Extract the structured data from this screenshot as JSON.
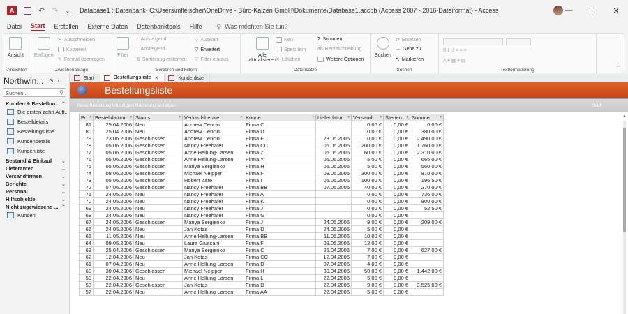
{
  "window": {
    "title": "Database1 : Datenbank- C:\\Users\\mfleischer\\OneDrive - Büro-Kaizen GmbH\\Dokumente\\Database1.accdb (Access 2007 - 2016-Dateiformat) - Access",
    "app_icon": "A",
    "min": "—",
    "max": "☐",
    "close": "✕"
  },
  "ribbon_tabs": [
    "Datei",
    "Start",
    "Erstellen",
    "Externe Daten",
    "Datenbanktools",
    "Hilfe"
  ],
  "active_tab": "Start",
  "tell_me": "Was möchten Sie tun?",
  "ribbon": {
    "ansicht": {
      "label": "Ansicht",
      "group": "Ansichten"
    },
    "clipboard": {
      "paste": "Einfügen",
      "cut": "Ausschneiden",
      "copy": "Kopieren",
      "format": "Format übertragen",
      "group": "Zwischenablage"
    },
    "sort": {
      "filter": "Filter",
      "asc": "Aufsteigend",
      "desc": "Absteigend",
      "remove": "Sortierung entfernen",
      "auswahl": "Auswahl",
      "erweitert": "Erweitert",
      "toggle": "Filter ein/aus",
      "group": "Sortieren und Filtern"
    },
    "records": {
      "refresh": "Alle aktualisieren",
      "new": "Neu",
      "save": "Speichern",
      "delete": "Löschen",
      "sum": "Summen",
      "spell": "Rechtschreibung",
      "more": "Weitere Optionen",
      "group": "Datensätze"
    },
    "find": {
      "find": "Suchen",
      "replace": "Ersetzen",
      "goto": "Gehe zu",
      "select": "Markieren",
      "group": "Suchen"
    },
    "textfmt": {
      "group": "Textformatierung"
    }
  },
  "nav": {
    "title": "Northwin...",
    "search_placeholder": "Suchen...",
    "sections": [
      {
        "label": "Kunden & Bestellun...",
        "chevron": "⌃"
      },
      {
        "label": "Bestand & Einkauf",
        "chevron": "⌄"
      },
      {
        "label": "Lieferanten",
        "chevron": "⌄"
      },
      {
        "label": "Versandfirmen",
        "chevron": "⌄"
      },
      {
        "label": "Berichte",
        "chevron": "⌄"
      },
      {
        "label": "Personal",
        "chevron": "⌄"
      },
      {
        "label": "Hilfsobjekte",
        "chevron": "⌄"
      },
      {
        "label": "Nicht zugewiesene ...",
        "chevron": "⌃"
      }
    ],
    "items": [
      "Die ersten zehn Auft...",
      "Bestelldetails",
      "Bestellungsliste",
      "Kundendetails",
      "Kundenliste"
    ],
    "unassigned": [
      "Kunden"
    ]
  },
  "doc_tabs": [
    {
      "label": "Start",
      "close": ""
    },
    {
      "label": "Bestellungsliste",
      "close": "✕"
    },
    {
      "label": "Kundenliste",
      "close": ""
    }
  ],
  "form": {
    "title": "Bestellungsliste",
    "link_new": "Neue Bestellung hinzufügen",
    "link_invoice": "Rechnung anzeigen",
    "link_start": "Start"
  },
  "table": {
    "columns": [
      "Po",
      "Bestelldatum",
      "Status",
      "Verkaufsberater",
      "Kunde",
      "Lieferdatur",
      "Versand",
      "Steuern",
      "Summe"
    ],
    "rows": [
      [
        "81",
        "25.04.2006",
        "Neu",
        "Andrew Cencini",
        "Firma C",
        "",
        "0,00 €",
        "0,00 €",
        "0,00 €"
      ],
      [
        "80",
        "25.04.2006",
        "Neu",
        "Andrew Cencini",
        "Firma D",
        "",
        "0,00 €",
        "0,00 €",
        "380,00 €"
      ],
      [
        "79",
        "23.06.2006",
        "Geschlossen",
        "Andrew Cencini",
        "Firma F",
        "23.06.2006",
        "0,00 €",
        "0,00 €",
        "2.490,00 €"
      ],
      [
        "78",
        "05.06.2006",
        "Geschlossen",
        "Nancy Freehafer",
        "Firma CC",
        "05.06.2006",
        "200,00 €",
        "0,00 €",
        "1.760,00 €"
      ],
      [
        "77",
        "05.06.2006",
        "Geschlossen",
        "Anne Hellung-Larsen",
        "Firma Z",
        "05.06.2006",
        "60,00 €",
        "0,00 €",
        "2.310,00 €"
      ],
      [
        "76",
        "05.06.2006",
        "Geschlossen",
        "Anne Hellung-Larsen",
        "Firma Y",
        "05.06.2006",
        "5,00 €",
        "0,00 €",
        "665,00 €"
      ],
      [
        "75",
        "05.06.2006",
        "Geschlossen",
        "Mariya Sergienko",
        "Firma H",
        "05.06.2006",
        "5,00 €",
        "0,00 €",
        "560,00 €"
      ],
      [
        "74",
        "08.06.2006",
        "Geschlossen",
        "Michael Neipper",
        "Firma F",
        "08.06.2006",
        "300,00 €",
        "0,00 €",
        "810,00 €"
      ],
      [
        "73",
        "05.06.2006",
        "Geschlossen",
        "Robert Zare",
        "Firma I",
        "05.06.2006",
        "100,00 €",
        "0,00 €",
        "196,50 €"
      ],
      [
        "72",
        "07.06.2006",
        "Geschlossen",
        "Nancy Freehafer",
        "Firma BB",
        "07.06.2006",
        "40,00 €",
        "0,00 €",
        "270,00 €"
      ],
      [
        "71",
        "24.05.2006",
        "Neu",
        "Nancy Freehafer",
        "Firma A",
        "",
        "0,00 €",
        "0,00 €",
        "736,00 €"
      ],
      [
        "70",
        "24.05.2006",
        "Neu",
        "Nancy Freehafer",
        "Firma K",
        "",
        "0,00 €",
        "0,00 €",
        "800,00 €"
      ],
      [
        "69",
        "24.05.2006",
        "Neu",
        "Nancy Freehafer",
        "Firma J",
        "",
        "0,00 €",
        "0,00 €",
        "52,50 €"
      ],
      [
        "68",
        "24.05.2006",
        "Neu",
        "Nancy Freehafer",
        "Firma G",
        "",
        "0,00 €",
        "0,00 €",
        ""
      ],
      [
        "67",
        "24.05.2006",
        "Geschlossen",
        "Mariya Sergienko",
        "Firma J",
        "24.05.2006",
        "9,00 €",
        "0,00 €",
        "209,00 €"
      ],
      [
        "66",
        "24.05.2006",
        "Neu",
        "Jan Kotas",
        "Firma D",
        "24.05.2006",
        "5,00 €",
        "0,00 €",
        ""
      ],
      [
        "65",
        "11.05.2006",
        "Neu",
        "Anne Hellung-Larsen",
        "Firma BB",
        "11.05.2006",
        "10,00 €",
        "0,00 €",
        ""
      ],
      [
        "64",
        "09.05.2006",
        "Neu",
        "Laura Giussani",
        "Firma F",
        "09.05.2006",
        "12,00 €",
        "0,00 €",
        ""
      ],
      [
        "63",
        "25.04.2006",
        "Geschlossen",
        "Mariya Sergienko",
        "Firma C",
        "25.04.2006",
        "7,00 €",
        "0,00 €",
        "627,00 €"
      ],
      [
        "62",
        "12.04.2006",
        "Neu",
        "Jan Kotas",
        "Firma CC",
        "12.04.2006",
        "7,00 €",
        "0,00 €",
        ""
      ],
      [
        "61",
        "07.04.2006",
        "Neu",
        "Anne Hellung-Larsen",
        "Firma D",
        "07.04.2006",
        "4,00 €",
        "0,00 €",
        ""
      ],
      [
        "60",
        "30.04.2006",
        "Geschlossen",
        "Michael Neipper",
        "Firma H",
        "30.04.2006",
        "50,00 €",
        "0,00 €",
        "1.442,00 €"
      ],
      [
        "59",
        "22.04.2006",
        "Neu",
        "Anne Hellung-Larsen",
        "Firma L",
        "22.04.2006",
        "5,00 €",
        "0,00 €",
        ""
      ],
      [
        "58",
        "22.04.2006",
        "Geschlossen",
        "Jan Kotas",
        "Firma D",
        "22.04.2006",
        "9,00 €",
        "0,00 €",
        "3.525,00 €"
      ],
      [
        "57",
        "22.04.2006",
        "Neu",
        "Anne Hellung-Larsen",
        "Firma AA",
        "22.04.2006",
        "5,00 €",
        "0,00 €",
        ""
      ]
    ]
  }
}
